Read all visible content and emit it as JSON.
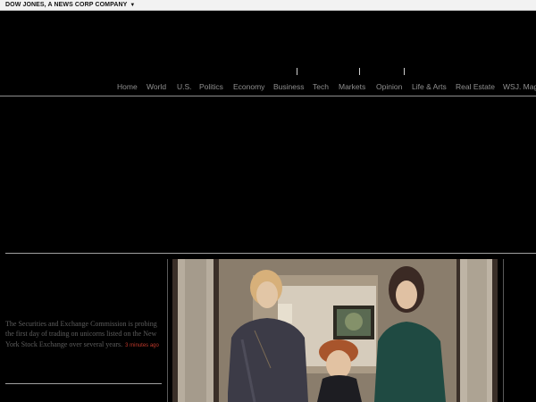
{
  "topbar": {
    "brand": "DOW JONES, A NEWS CORP COMPANY",
    "caret": "▼"
  },
  "nav": {
    "items": [
      "Home",
      "World",
      "U.S.",
      "Politics",
      "Economy",
      "Business",
      "Tech",
      "Markets",
      "Opinion",
      "Life & Arts",
      "Real Estate",
      "WSJ. Mag"
    ]
  },
  "story": {
    "summary": "The Securities and Exchange Commission is probing the first day of trading on unicorns listed on the New York Stock Exchange over several years.",
    "timestamp": "3 minutes ago"
  },
  "photo": {
    "subject": "three women standing indoors"
  }
}
